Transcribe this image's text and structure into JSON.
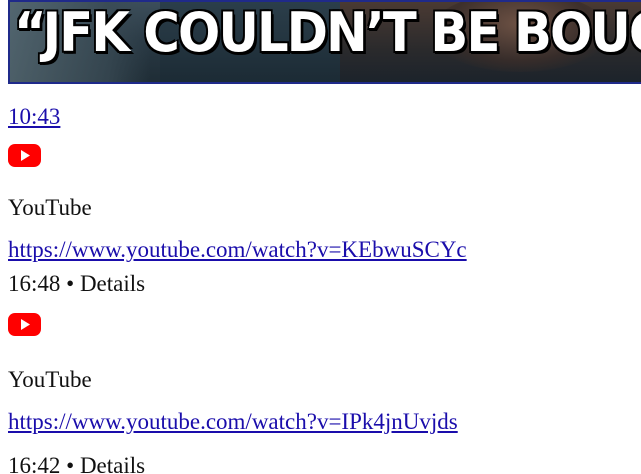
{
  "thumbnail": {
    "headline": "“JFK COULDN’T BE BOUGHT”"
  },
  "results": [
    {
      "duration": "10:43",
      "source_icon": "youtube-icon",
      "source_name": "YouTube",
      "url": "https://www.youtube.com/watch?v=KEbwuSCYc"
    },
    {
      "meta": "16:48 • Details",
      "source_icon": "youtube-icon",
      "source_name": "YouTube",
      "url": "https://www.youtube.com/watch?v=IPk4jnUvjds"
    },
    {
      "meta": "16:42 • Details"
    }
  ],
  "colors": {
    "link": "#1a0dab",
    "youtube_red": "#ff0000",
    "thumbnail_border": "#1f2a8a"
  }
}
